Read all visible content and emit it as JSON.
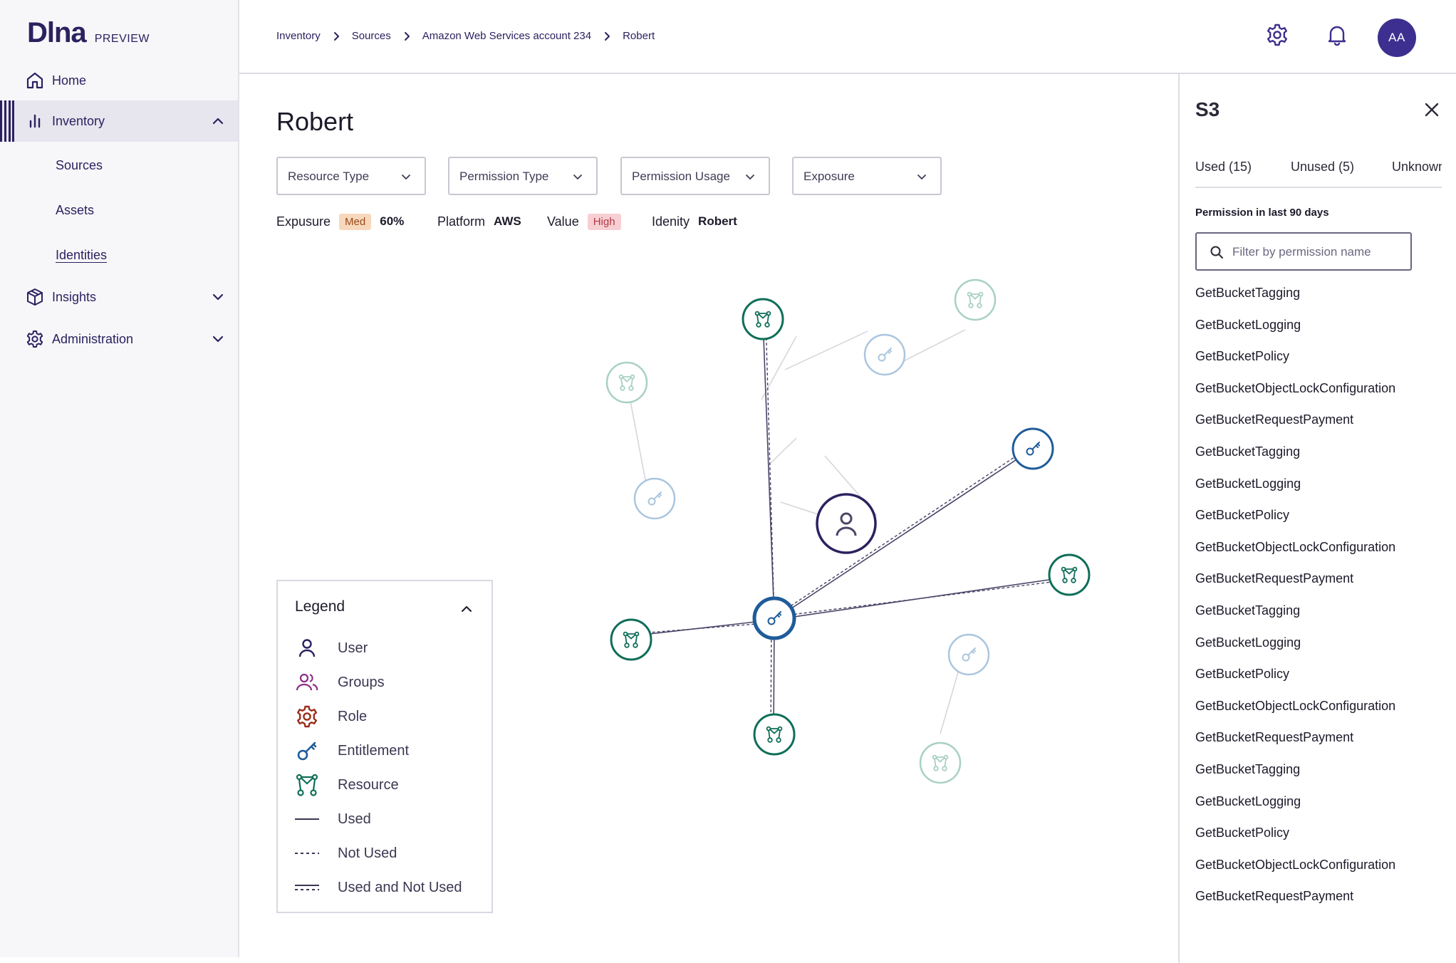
{
  "app": {
    "logo": "Dlna",
    "tag": "PREVIEW"
  },
  "nav": {
    "home": "Home",
    "inventory": "Inventory",
    "sub": [
      "Sources",
      "Assets",
      "Identities"
    ],
    "insights": "Insights",
    "administration": "Administration"
  },
  "breadcrumb": [
    "Inventory",
    "Sources",
    "Amazon Web Services account 234",
    "Robert"
  ],
  "user_avatar": "AA",
  "page": {
    "title": "Robert",
    "filters": [
      "Resource Type",
      "Permission Type",
      "Permission Usage",
      "Exposure"
    ],
    "meta": {
      "exposure_label": "Expusure",
      "exposure_badge": "Med",
      "exposure_value": "60%",
      "platform_label": "Platform",
      "platform_value": "AWS",
      "value_label": "Value",
      "value_badge": "High",
      "identity_label": "Idenity",
      "identity_value": "Robert"
    }
  },
  "legend": {
    "title": "Legend",
    "items": [
      "User",
      "Groups",
      "Role",
      "Entitlement",
      "Resource",
      "Used",
      "Not Used",
      "Used and Not Used"
    ]
  },
  "colors": {
    "user": "#2a2260",
    "groups": "#8a2d86",
    "role": "#9a2d1a",
    "entitlement": "#1f5c99",
    "resource": "#0f6e58",
    "accent": "#3c2f8f"
  },
  "panel": {
    "title": "S3",
    "tabs": [
      "Used (15)",
      "Unused (5)",
      "Unknown"
    ],
    "subtitle": "Permission in last 90 days",
    "search_placeholder": "Filter by permission name",
    "permissions": [
      "GetBucketTagging",
      "GetBucketLogging",
      "GetBucketPolicy",
      "GetBucketObjectLockConfiguration",
      "GetBucketRequestPayment",
      "GetBucketTagging",
      "GetBucketLogging",
      "GetBucketPolicy",
      "GetBucketObjectLockConfiguration",
      "GetBucketRequestPayment",
      "GetBucketTagging",
      "GetBucketLogging",
      "GetBucketPolicy",
      "GetBucketObjectLockConfiguration",
      "GetBucketRequestPayment",
      "GetBucketTagging",
      "GetBucketLogging",
      "GetBucketPolicy",
      "GetBucketObjectLockConfiguration",
      "GetBucketRequestPayment"
    ]
  }
}
